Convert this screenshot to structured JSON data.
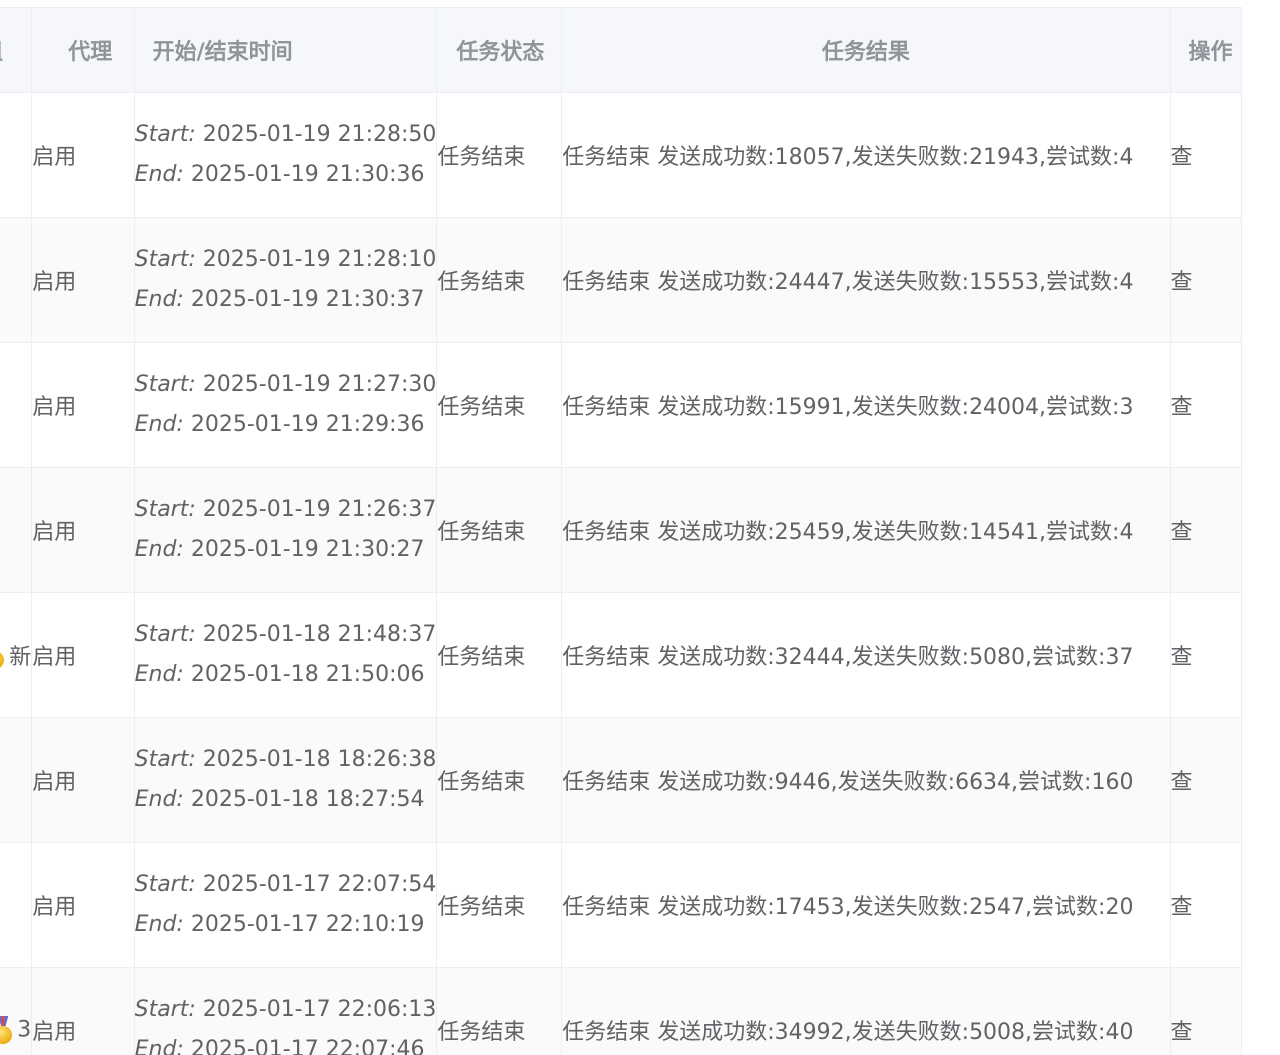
{
  "table": {
    "headers": {
      "group": "组",
      "proxy": "代理",
      "time": "开始/结束时间",
      "status": "任务状态",
      "result": "任务结果",
      "op": "操作"
    },
    "start_label": "Start:",
    "end_label": "End:",
    "rows": [
      {
        "group": "",
        "medal": false,
        "proxy": "启用",
        "start": "2025-01-19 21:28:50",
        "end": "2025-01-19 21:30:36",
        "status": "任务结束",
        "result": "任务结束 发送成功数:18057,发送失败数:21943,尝试数:4",
        "op": "查"
      },
      {
        "group": "",
        "medal": false,
        "proxy": "启用",
        "start": "2025-01-19 21:28:10",
        "end": "2025-01-19 21:30:37",
        "status": "任务结束",
        "result": "任务结束 发送成功数:24447,发送失败数:15553,尝试数:4",
        "op": "查"
      },
      {
        "group": "",
        "medal": false,
        "proxy": "启用",
        "start": "2025-01-19 21:27:30",
        "end": "2025-01-19 21:29:36",
        "status": "任务结束",
        "result": "任务结束 发送成功数:15991,发送失败数:24004,尝试数:3",
        "op": "查"
      },
      {
        "group": "",
        "medal": false,
        "proxy": "启用",
        "start": "2025-01-19 21:26:37",
        "end": "2025-01-19 21:30:27",
        "status": "任务结束",
        "result": "任务结束 发送成功数:25459,发送失败数:14541,尝试数:4",
        "op": "查"
      },
      {
        "group": "新",
        "medal": true,
        "proxy": "启用",
        "start": "2025-01-18 21:48:37",
        "end": "2025-01-18 21:50:06",
        "status": "任务结束",
        "result": "任务结束 发送成功数:32444,发送失败数:5080,尝试数:37",
        "op": "查"
      },
      {
        "group": "",
        "medal": false,
        "proxy": "启用",
        "start": "2025-01-18 18:26:38",
        "end": "2025-01-18 18:27:54",
        "status": "任务结束",
        "result": "任务结束 发送成功数:9446,发送失败数:6634,尝试数:160",
        "op": "查"
      },
      {
        "group": "",
        "medal": false,
        "proxy": "启用",
        "start": "2025-01-17 22:07:54",
        "end": "2025-01-17 22:10:19",
        "status": "任务结束",
        "result": "任务结束 发送成功数:17453,发送失败数:2547,尝试数:20",
        "op": "查"
      },
      {
        "group": "3",
        "medal": true,
        "proxy": "启用",
        "start": "2025-01-17 22:06:13",
        "end": "2025-01-17 22:07:46",
        "status": "任务结束",
        "result": "任务结束 发送成功数:34992,发送失败数:5008,尝试数:40",
        "op": "查"
      }
    ]
  }
}
